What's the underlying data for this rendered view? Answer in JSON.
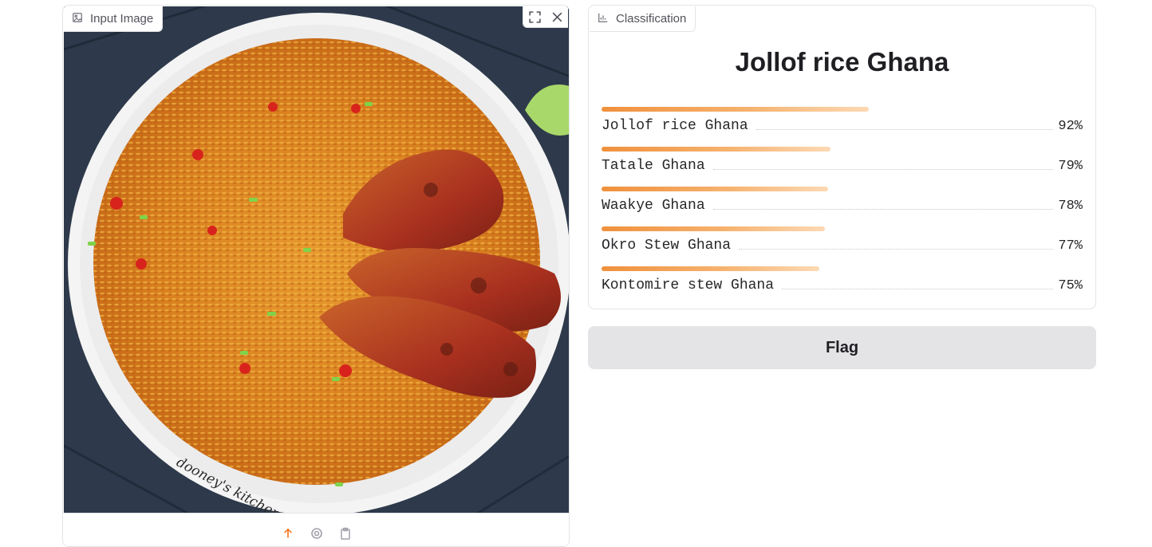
{
  "input": {
    "label": "Input Image",
    "label_icon": "image-icon",
    "tools": [
      "fullscreen-icon",
      "close-icon"
    ],
    "image_watermark": "dooney's kitchen",
    "sources": [
      "upload-icon",
      "webcam-icon",
      "clipboard-icon"
    ]
  },
  "output": {
    "label": "Classification",
    "label_icon": "bar-chart-icon",
    "top_label": "Jollof rice Ghana",
    "confidences": [
      {
        "label": "Jollof rice Ghana",
        "value": 0.92,
        "pct": "92%"
      },
      {
        "label": "Tatale Ghana",
        "value": 0.79,
        "pct": "79%"
      },
      {
        "label": "Waakye Ghana",
        "value": 0.78,
        "pct": "78%"
      },
      {
        "label": "Okro Stew Ghana",
        "value": 0.77,
        "pct": "77%"
      },
      {
        "label": "Kontomire stew Ghana",
        "value": 0.75,
        "pct": "75%"
      }
    ],
    "bar_color": "#f0903d"
  },
  "flag_button": {
    "label": "Flag"
  }
}
